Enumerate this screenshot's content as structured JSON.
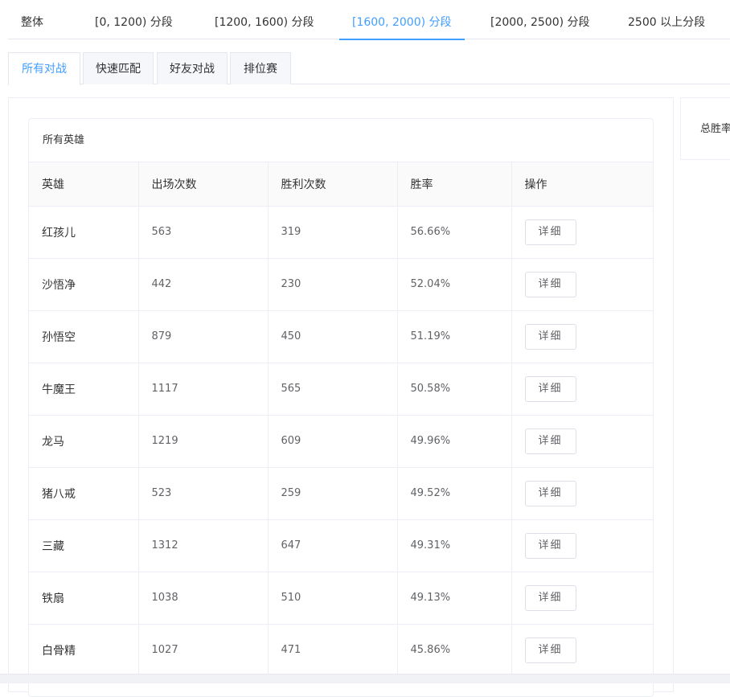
{
  "range_tabs": [
    {
      "label": "整体",
      "active": false
    },
    {
      "label": "[0, 1200) 分段",
      "active": false
    },
    {
      "label": "[1200, 1600) 分段",
      "active": false
    },
    {
      "label": "[1600, 2000) 分段",
      "active": true
    },
    {
      "label": "[2000, 2500) 分段",
      "active": false
    },
    {
      "label": "2500 以上分段",
      "active": false
    }
  ],
  "mode_tabs": [
    {
      "label": "所有对战",
      "active": true
    },
    {
      "label": "快速匹配",
      "active": false
    },
    {
      "label": "好友对战",
      "active": false
    },
    {
      "label": "排位赛",
      "active": false
    }
  ],
  "card": {
    "title": "所有英雄"
  },
  "table": {
    "columns": [
      "英雄",
      "出场次数",
      "胜利次数",
      "胜率",
      "操作"
    ],
    "rows": [
      {
        "hero": "红孩儿",
        "appearances": "563",
        "wins": "319",
        "win_rate": "56.66%",
        "action": "详细"
      },
      {
        "hero": "沙悟净",
        "appearances": "442",
        "wins": "230",
        "win_rate": "52.04%",
        "action": "详细"
      },
      {
        "hero": "孙悟空",
        "appearances": "879",
        "wins": "450",
        "win_rate": "51.19%",
        "action": "详细"
      },
      {
        "hero": "牛魔王",
        "appearances": "1117",
        "wins": "565",
        "win_rate": "50.58%",
        "action": "详细"
      },
      {
        "hero": "龙马",
        "appearances": "1219",
        "wins": "609",
        "win_rate": "49.96%",
        "action": "详细"
      },
      {
        "hero": "猪八戒",
        "appearances": "523",
        "wins": "259",
        "win_rate": "49.52%",
        "action": "详细"
      },
      {
        "hero": "三藏",
        "appearances": "1312",
        "wins": "647",
        "win_rate": "49.31%",
        "action": "详细"
      },
      {
        "hero": "铁扇",
        "appearances": "1038",
        "wins": "510",
        "win_rate": "49.13%",
        "action": "详细"
      },
      {
        "hero": "白骨精",
        "appearances": "1027",
        "wins": "471",
        "win_rate": "45.86%",
        "action": "详细"
      }
    ]
  },
  "side_panel": {
    "label": "总胜率"
  },
  "colors": {
    "accent": "#409eff",
    "border": "#ebeef5",
    "header_bg": "#fafafa"
  }
}
